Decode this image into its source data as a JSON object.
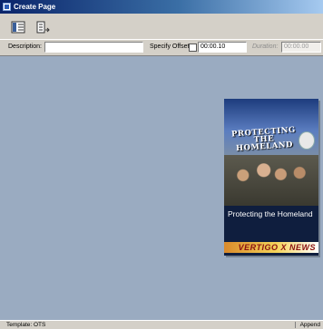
{
  "window": {
    "title": "Create Page",
    "icon": "app-icon"
  },
  "toolbar": {
    "buttons": [
      {
        "icon": "page-layout-icon"
      },
      {
        "icon": "append-page-icon"
      }
    ]
  },
  "fields": {
    "description_label": "Description:",
    "description_value": "",
    "specify_offset_label": "Specify Offset:",
    "specify_offset_checked": false,
    "offset_value": "00:00.10",
    "duration_label": "Duration:",
    "duration_value": "00:00.00"
  },
  "preview": {
    "headline": "PROTECTING THE HOMELAND",
    "caption": "Protecting the Homeland",
    "banner": "VERTIGO X NEWS"
  },
  "statusbar": {
    "template": "Template: OTS",
    "mode": "Append"
  }
}
